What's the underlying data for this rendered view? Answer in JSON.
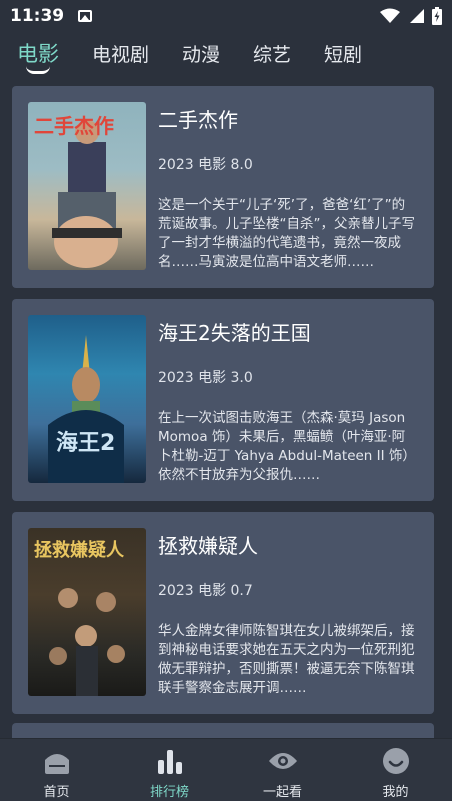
{
  "status": {
    "time": "11:39"
  },
  "tabs": [
    {
      "label": "电影"
    },
    {
      "label": "电视剧"
    },
    {
      "label": "动漫"
    },
    {
      "label": "综艺"
    },
    {
      "label": "短剧"
    }
  ],
  "movies": [
    {
      "poster_text": "二手杰作",
      "title": "二手杰作",
      "meta": "2023 电影 8.0",
      "desc": "这是一个关于“儿子‘死’了，爸爸‘红’了”的荒诞故事。儿子坠楼“自杀”，父亲替儿子写了一封才华横溢的代笔遗书，竟然一夜成名……马寅波是位高中语文老师……"
    },
    {
      "poster_text": "海王2",
      "title": "海王2失落的王国",
      "meta": "2023 电影 3.0",
      "desc": "在上一次试图击败海王（杰森·莫玛 Jason Momoa 饰）未果后，黑蝠鲼（叶海亚·阿卜杜勒-迈丁 Yahya Abdul-Mateen II 饰）依然不甘放弃为父报仇……"
    },
    {
      "poster_text": "拯救嫌疑人",
      "title": "拯救嫌疑人",
      "meta": "2023 电影 0.7",
      "desc": "华人金牌女律师陈智琪在女儿被绑架后，接到神秘电话要求她在五天之内为一位死刑犯做无罪辩护，否则撕票！被逼无奈下陈智琪联手警察金志展开调……"
    }
  ],
  "bottom_nav": [
    {
      "label": "首页",
      "icon": "home-icon"
    },
    {
      "label": "排行榜",
      "icon": "ranking-icon"
    },
    {
      "label": "一起看",
      "icon": "eye-icon"
    },
    {
      "label": "我的",
      "icon": "profile-icon"
    }
  ],
  "colors": {
    "accent": "#7fd9c9",
    "background": "#2b313c",
    "card": "#4a5468"
  }
}
